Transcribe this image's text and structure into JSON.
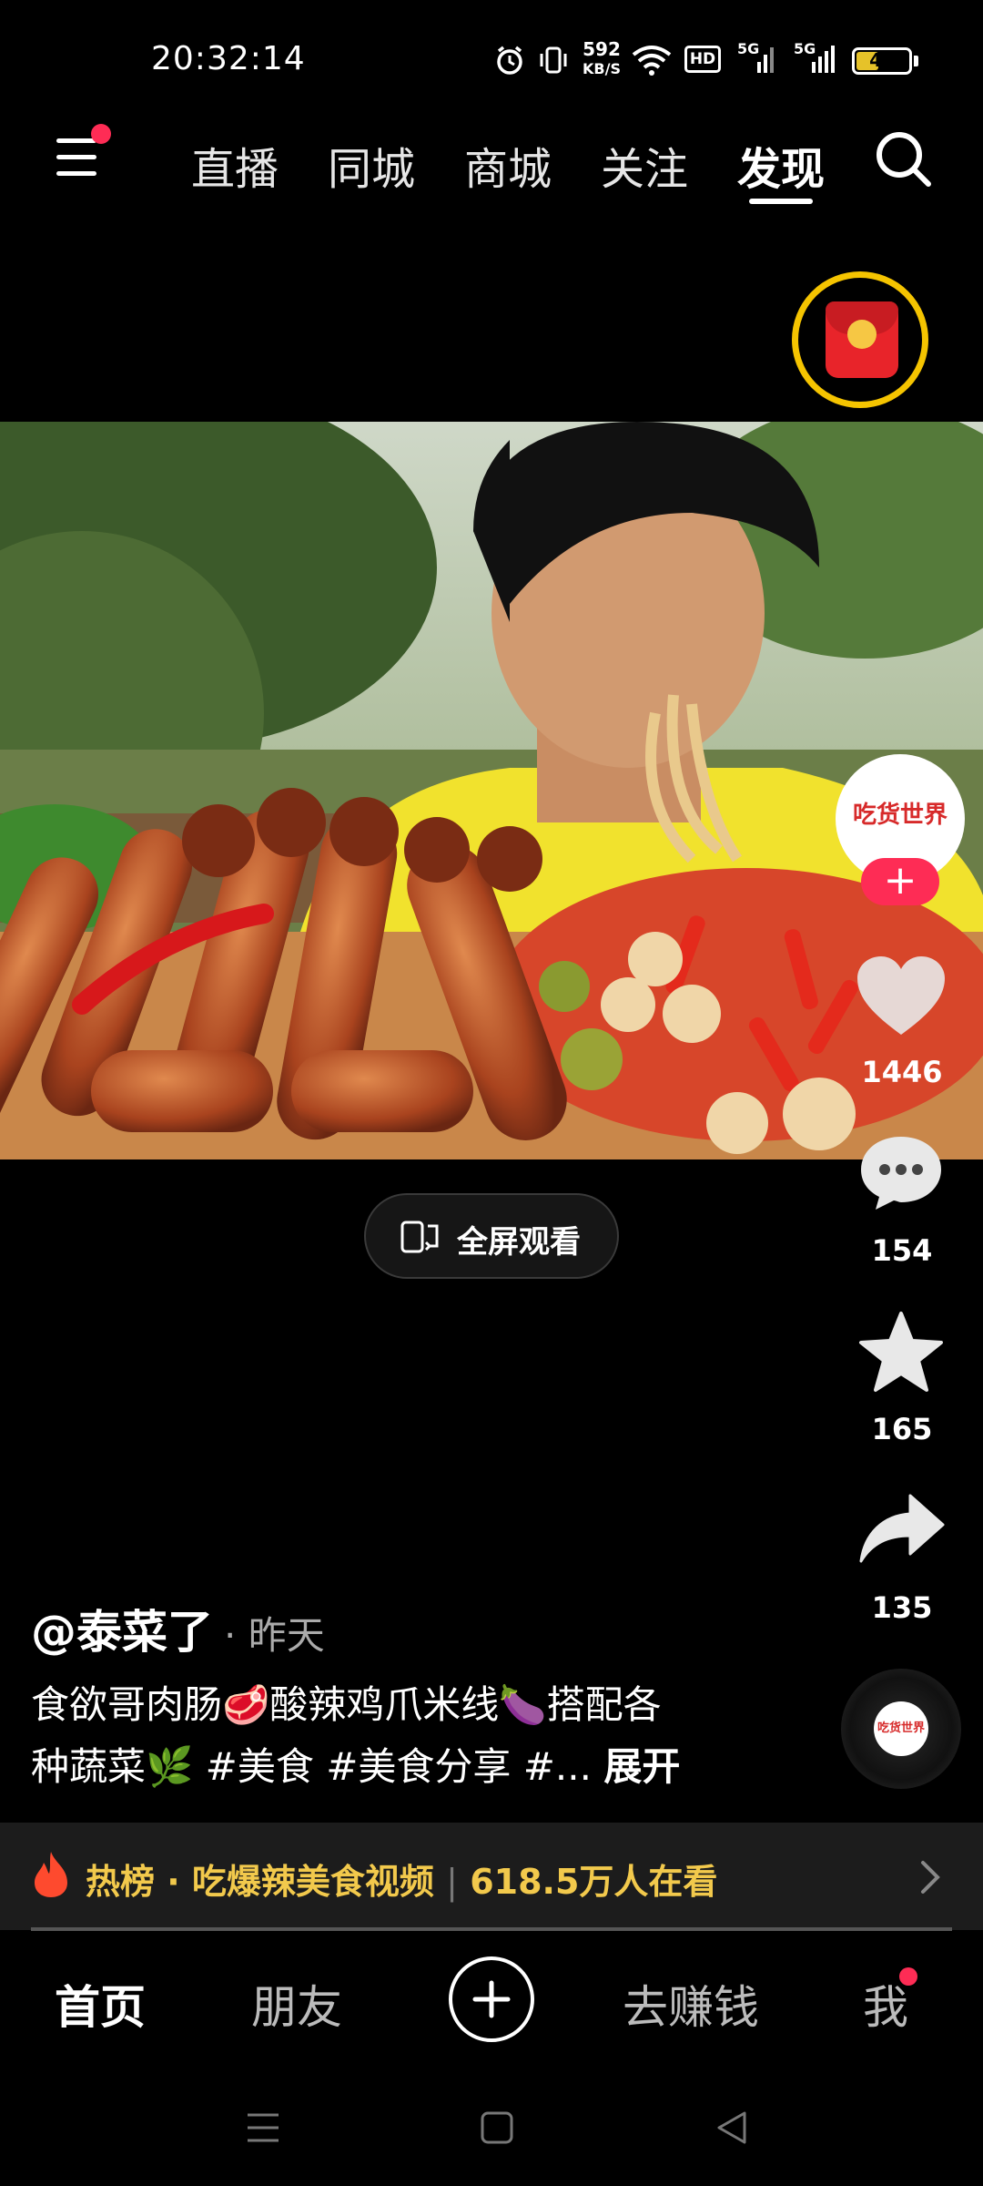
{
  "status_bar": {
    "time": "20:32:14",
    "net_speed_value": "592",
    "net_speed_unit": "KB/S",
    "hd_label": "HD",
    "signal1_label": "5G",
    "signal2_label": "5G",
    "battery": "40",
    "icons": [
      "alarm-icon",
      "vibrate-icon",
      "wifi-icon",
      "hd-icon",
      "signal-icon",
      "signal-icon",
      "battery-icon"
    ]
  },
  "top_nav": {
    "tabs": [
      {
        "label": "直播"
      },
      {
        "label": "同城"
      },
      {
        "label": "商城"
      },
      {
        "label": "关注"
      },
      {
        "label": "发现"
      }
    ],
    "active_tab": "发现"
  },
  "video": {
    "fullscreen_label": "全屏观看"
  },
  "creator": {
    "avatar_text": "吃货世界",
    "follow_symbol": "+"
  },
  "actions": {
    "likes": "1446",
    "comments": "154",
    "favorites": "165",
    "shares": "135"
  },
  "music": {
    "disc_text": "吃货世界"
  },
  "post": {
    "author": "@泰菜了",
    "time": "· 昨天",
    "caption_line1": "食欲哥肉肠🥩酸辣鸡爪米线🍆搭配各",
    "caption_line2": "种蔬菜🌿 #美食 #美食分享 #...",
    "expand_label": "展开"
  },
  "hot_bar": {
    "label": "热榜 · 吃爆辣美食视频",
    "separator": "|",
    "viewers": "618.5万人在看"
  },
  "bottom_nav": {
    "home": "首页",
    "friends": "朋友",
    "create": "+",
    "earn": "去赚钱",
    "me": "我"
  },
  "colors": {
    "accent": "#fe2c55",
    "hot_text": "#f2c94c",
    "red_packet_ring": "#f5c400"
  }
}
